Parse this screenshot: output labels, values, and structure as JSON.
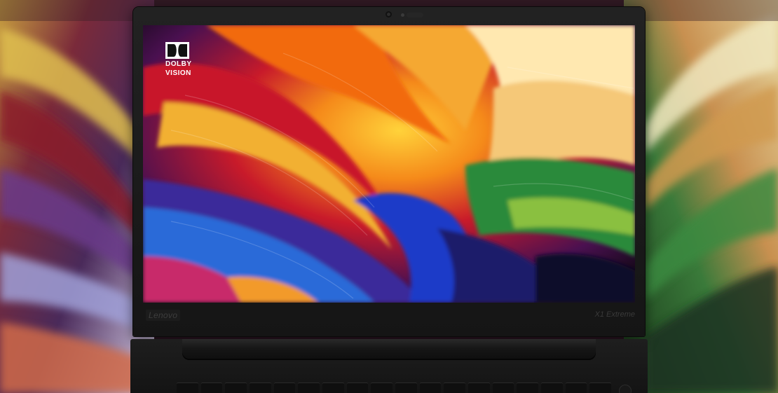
{
  "scene": {
    "description_colors": {
      "bezel": "#151515",
      "accent_orange": "#f27a1a",
      "accent_red": "#d81b2c",
      "accent_blue": "#2a4fd8",
      "accent_green": "#2a8a3a",
      "accent_yellow": "#f2c230",
      "accent_purple": "#6a2a8a"
    }
  },
  "screen": {
    "badge": {
      "icon": "dolby-double-d-icon",
      "line1": "DOLBY",
      "line2": "VISION"
    }
  },
  "bezel": {
    "brand": "Lenovo",
    "model": "X1 Extreme"
  },
  "keyboard": {
    "visible_key_count": 18
  }
}
